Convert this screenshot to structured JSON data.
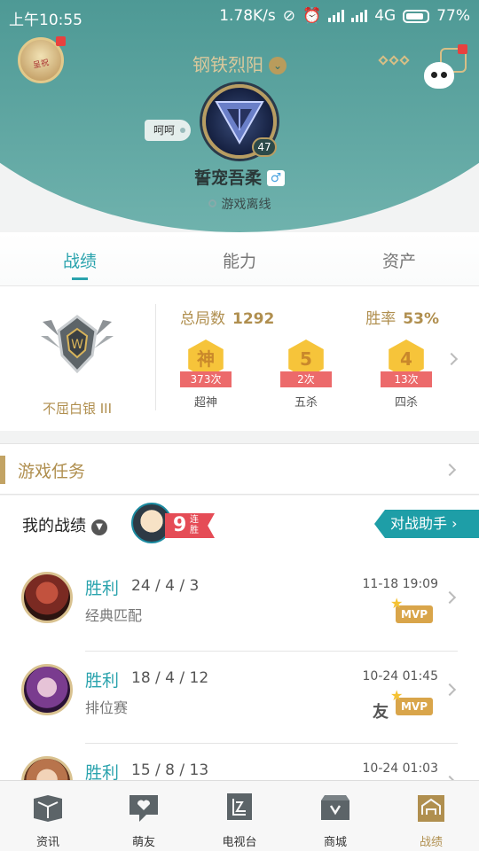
{
  "status_bar": {
    "time": "上午10:55",
    "speed": "1.78K/s",
    "network": "4G",
    "battery": "77%"
  },
  "header": {
    "top_name": "钢铁烈阳",
    "level": "47",
    "status_bubble": "呵呵",
    "player_name": "誓宠吾柔",
    "gender_symbol": "♂",
    "online_status": "游戏离线",
    "avatar_tag": "呈祝"
  },
  "tabs": [
    {
      "label": "战绩",
      "active": true
    },
    {
      "label": "能力",
      "active": false
    },
    {
      "label": "资产",
      "active": false
    }
  ],
  "stats": {
    "rank_name": "不屈白银 III",
    "total_label": "总局数",
    "total_value": "1292",
    "winrate_label": "胜率",
    "winrate_value": "53%",
    "medals": [
      {
        "icon_text": "神",
        "count": "373次",
        "label": "超神"
      },
      {
        "icon_text": "5",
        "count": "2次",
        "label": "五杀"
      },
      {
        "icon_text": "4",
        "count": "13次",
        "label": "四杀"
      }
    ]
  },
  "task": {
    "title": "游戏任务"
  },
  "records": {
    "title": "我的战绩",
    "streak_num": "9",
    "streak_text": "连胜",
    "assist_label": "对战助手",
    "matches": [
      {
        "result": "胜利",
        "kda": "24 / 4 / 3",
        "mode": "经典匹配",
        "date": "11-18 19:09",
        "mvp": "MVP",
        "friend": "",
        "hero_color": "#7a2a22"
      },
      {
        "result": "胜利",
        "kda": "18 / 4 / 12",
        "mode": "排位赛",
        "date": "10-24 01:45",
        "mvp": "MVP",
        "friend": "友",
        "hero_color": "#5a2f6e"
      },
      {
        "result": "胜利",
        "kda": "15 / 8 / 13",
        "mode": "",
        "date": "10-24 01:03",
        "mvp": "",
        "friend": "",
        "hero_color": "#b8744c"
      }
    ]
  },
  "nav": [
    {
      "label": "资讯",
      "icon": "book-icon",
      "active": false
    },
    {
      "label": "萌友",
      "icon": "chat-heart-icon",
      "active": false
    },
    {
      "label": "电视台",
      "icon": "tv-icon",
      "active": false
    },
    {
      "label": "商城",
      "icon": "shop-icon",
      "active": false
    },
    {
      "label": "战绩",
      "icon": "record-icon",
      "active": true
    }
  ],
  "colors": {
    "teal": "#2aa3ad",
    "gold": "#b08f4f",
    "header_bg": "#4f9a96",
    "medal_red": "#ec6a6b"
  }
}
